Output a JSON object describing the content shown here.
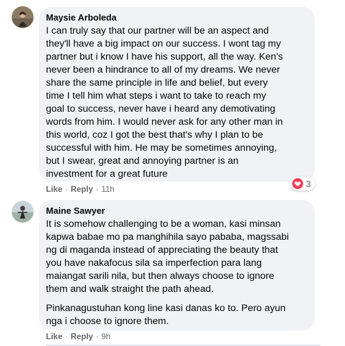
{
  "comments": [
    {
      "author": "Maysie Arboleda",
      "paragraphs": [
        "I can truly say that our partner will be an aspect and\nthey'll have a big impact on our success. I wont tag my\npartner but i know I have his support, all the way. Ken's\nnever been a hindrance to all of my dreams. We never\nshare the same principle in life and belief, but every\ntime I tell him what steps i want to take to reach my\ngoal to success, never have i heard any demotivating\nwords from him. I would never ask for any other man in\nthis world, coz I got the best that's why I plan to be\nsuccessful with him. He may be sometimes annoying,\nbut I swear, great and annoying partner is an\ninvestment for a great future"
      ],
      "like_label": "Like",
      "reply_label": "Reply",
      "separator": "·",
      "time": "11h",
      "reaction_count": "3",
      "reaction_icon": "heart-icon",
      "reaction_color": "#f33e58"
    },
    {
      "author": "Maine Sawyer",
      "paragraphs": [
        "It is somehow challenging to be a woman, kasi minsan\nkapwa babae mo pa manghihila sayo pababa, magssabi\nng di maganda instead of appreciating the beauty that\nyou have nakafocus sila sa imperfection para lang\nmaiangat sarili nila, but then always choose to ignore\nthem and walk straight the path ahead.",
        "Pinkanagustuhan kong line kasi danas ko to. Pero ayun\nnga i choose to ignore them."
      ],
      "like_label": "Like",
      "reply_label": "Reply",
      "separator": "·",
      "time": "9h"
    }
  ],
  "colors": {
    "bubble": "#f0f2f5",
    "text": "#050505",
    "secondary": "#65676b"
  }
}
